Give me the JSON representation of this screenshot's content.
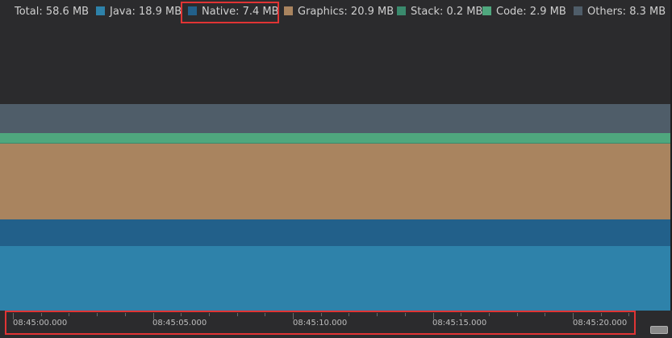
{
  "legend": {
    "total": "Total: 58.6 MB",
    "items": [
      {
        "label": "Java: 18.9 MB",
        "color": "#2e82aa"
      },
      {
        "label": "Native: 7.4 MB",
        "color": "#22608a"
      },
      {
        "label": "Graphics: 20.9 MB",
        "color": "#a9845f"
      },
      {
        "label": "Stack: 0.2 MB",
        "color": "#3a8a6d"
      },
      {
        "label": "Code: 2.9 MB",
        "color": "#4fa77e"
      },
      {
        "label": "Others: 8.3 MB",
        "color": "#4f5d69"
      }
    ]
  },
  "timeline": {
    "labels": [
      "08:45:00.000",
      "08:45:05.000",
      "08:45:10.000",
      "08:45:15.000",
      "08:45:20.000"
    ]
  },
  "chart_data": {
    "type": "area",
    "title": "",
    "xlabel": "",
    "ylabel": "",
    "x": [
      "08:45:00.000",
      "08:45:05.000",
      "08:45:10.000",
      "08:45:15.000",
      "08:45:20.000"
    ],
    "series": [
      {
        "name": "Java",
        "values": [
          18.9,
          18.9,
          18.9,
          18.9,
          18.9
        ]
      },
      {
        "name": "Native",
        "values": [
          7.4,
          7.4,
          7.4,
          7.4,
          7.4
        ]
      },
      {
        "name": "Graphics",
        "values": [
          20.9,
          20.9,
          20.9,
          20.9,
          20.9
        ]
      },
      {
        "name": "Stack",
        "values": [
          0.2,
          0.2,
          0.2,
          0.2,
          0.2
        ]
      },
      {
        "name": "Code",
        "values": [
          2.9,
          2.9,
          2.9,
          2.9,
          2.9
        ]
      },
      {
        "name": "Others",
        "values": [
          8.3,
          8.3,
          8.3,
          8.3,
          8.3
        ]
      }
    ],
    "stacked": true,
    "grid": false,
    "legend": "top"
  }
}
